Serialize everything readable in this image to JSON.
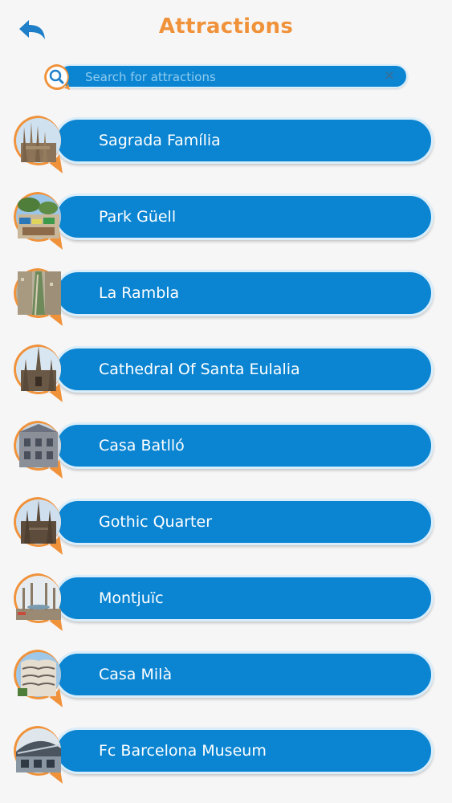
{
  "header": {
    "title": "Attractions",
    "back_icon": "back-arrow-icon"
  },
  "search": {
    "placeholder": "Search for attractions",
    "value": "",
    "clear_label": "✕",
    "icon": "search-icon"
  },
  "colors": {
    "accent": "#f0923a",
    "bar": "#0b85d2",
    "bar_border": "#d9edfa",
    "background": "#f6f6f7"
  },
  "attractions": [
    {
      "label": "Sagrada Família",
      "icon": "sagrada-familia-thumbnail"
    },
    {
      "label": "Park Güell",
      "icon": "park-guell-thumbnail"
    },
    {
      "label": "La Rambla",
      "icon": "la-rambla-thumbnail"
    },
    {
      "label": "Cathedral Of Santa Eulalia",
      "icon": "cathedral-thumbnail"
    },
    {
      "label": "Casa Batlló",
      "icon": "casa-batllo-thumbnail"
    },
    {
      "label": "Gothic Quarter",
      "icon": "gothic-quarter-thumbnail"
    },
    {
      "label": "Montjuïc",
      "icon": "montjuic-thumbnail"
    },
    {
      "label": "Casa Milà",
      "icon": "casa-mila-thumbnail"
    },
    {
      "label": "Fc Barcelona Museum",
      "icon": "fc-barcelona-museum-thumbnail"
    }
  ]
}
